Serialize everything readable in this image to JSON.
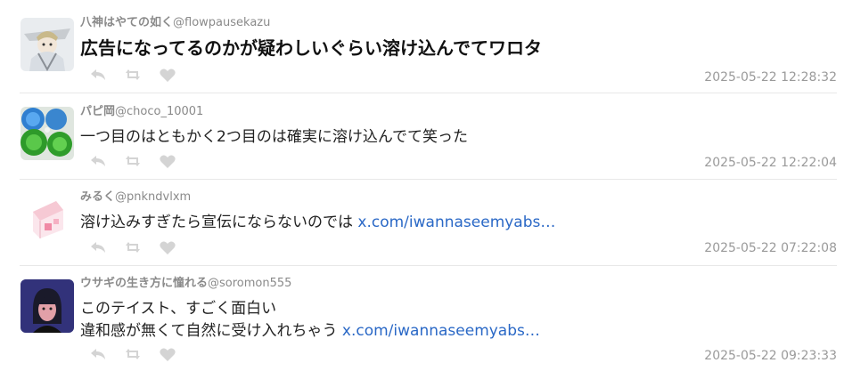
{
  "tweets": [
    {
      "name": "八神はやての如く",
      "handle": "@flowpausekazu",
      "lines": [
        "広告になってるのかが疑わしいぐらい溶け込んでてワロタ"
      ],
      "link": "",
      "time": "2025-05-22 12:28:32",
      "big": true
    },
    {
      "name": "パピ岡",
      "handle": "@choco_10001",
      "lines": [
        "一つ目のはともかく2つ目のは確実に溶け込んでて笑った"
      ],
      "link": "",
      "time": "2025-05-22 12:22:04",
      "big": false
    },
    {
      "name": "みるく",
      "handle": "@pnkndvlxm",
      "lines": [
        "溶け込みすぎたら宣伝にならないのでは "
      ],
      "link": "x.com/iwannaseemyabs…",
      "time": "2025-05-22 07:22:08",
      "big": false
    },
    {
      "name": "ウサギの生き方に憧れる",
      "handle": "@soromon555",
      "lines": [
        "このテイスト、すごく面白い",
        "違和感が無くて自然に受け入れちゃう "
      ],
      "link": "x.com/iwannaseemyabs…",
      "time": "2025-05-22 09:23:33",
      "big": false
    }
  ],
  "icons": {
    "reply": "reply-icon",
    "retweet": "retweet-icon",
    "like": "heart-icon"
  },
  "colors": {
    "name": "#8a8a8a",
    "link": "#2a68c6",
    "text": "#222222",
    "timestamp": "#9a9a9a",
    "icon": "#d4d4d4",
    "divider": "#e8e8e8"
  }
}
